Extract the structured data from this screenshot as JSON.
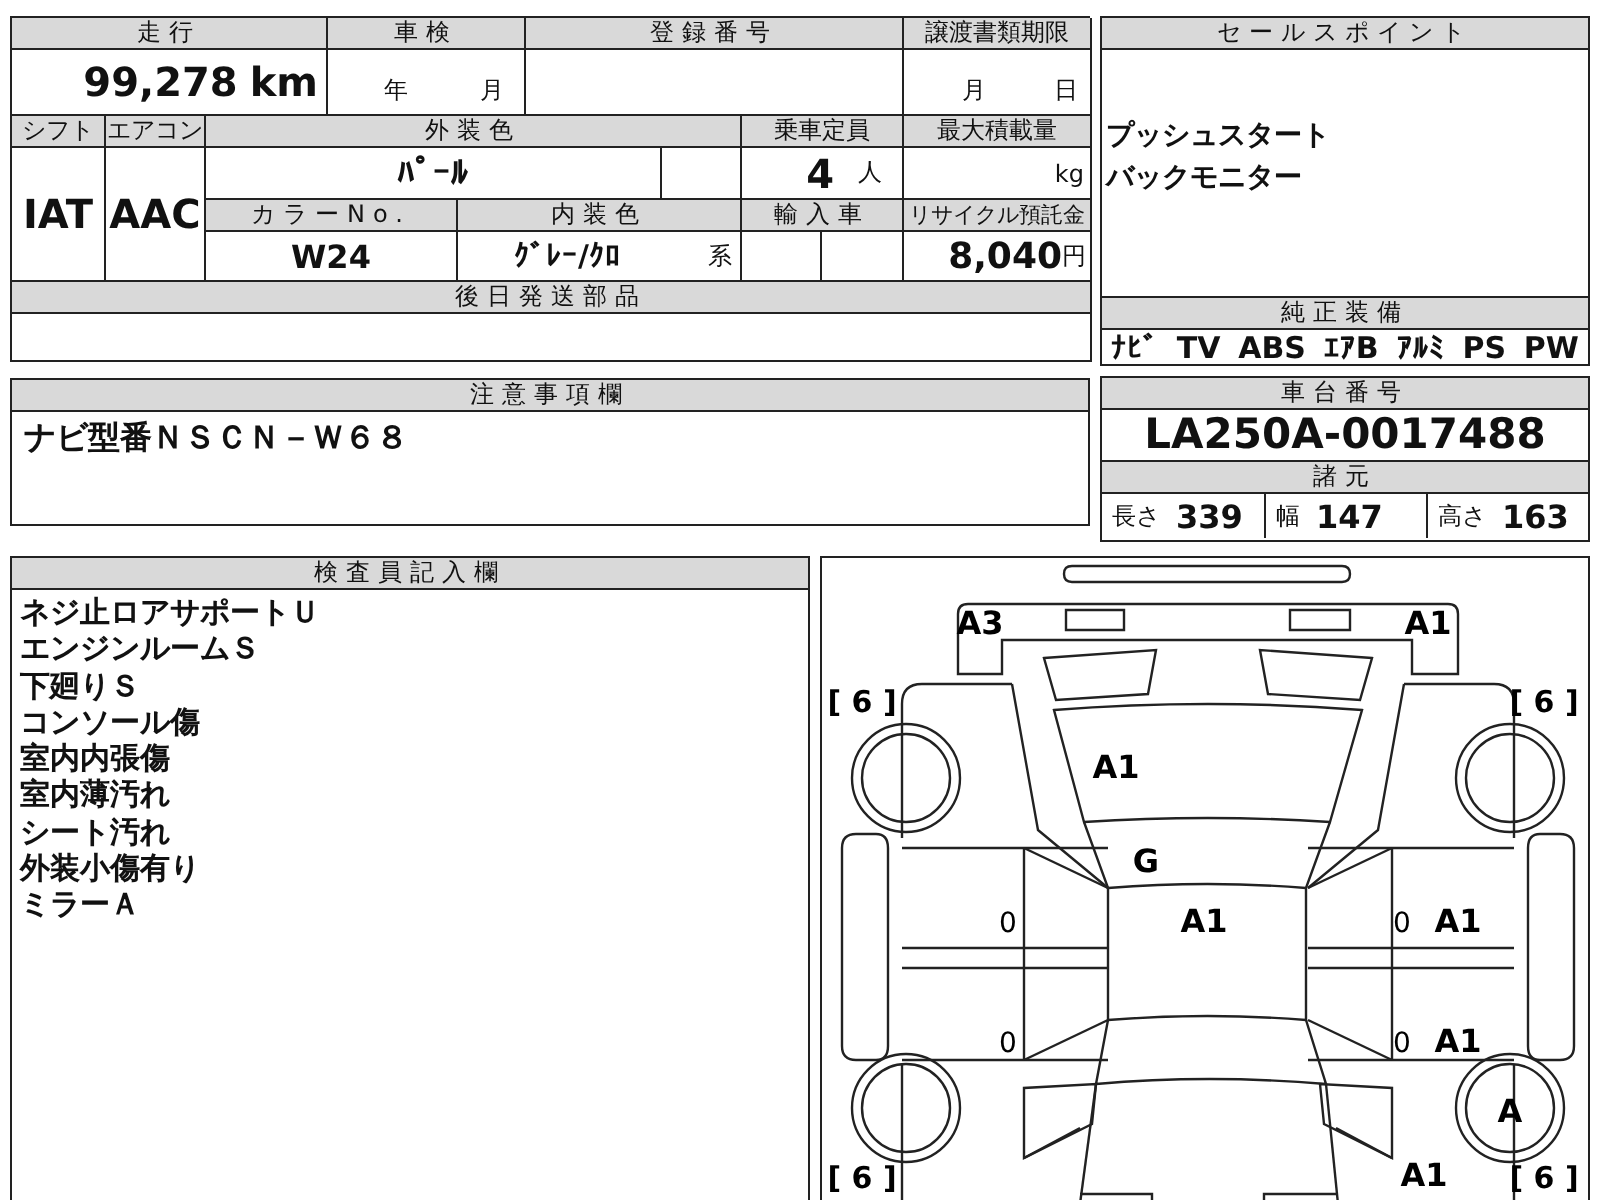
{
  "summary": {
    "mileage_label": "走行",
    "mileage": "99,278",
    "mileage_unit": "km",
    "inspection_label": "車検",
    "inspection_year_unit": "年",
    "inspection_month_unit": "月",
    "registration_label": "登録番号",
    "transfer_deadline_label": "譲渡書類期限",
    "transfer_month_unit": "月",
    "transfer_day_unit": "日",
    "shift_label": "シフト",
    "shift": "IAT",
    "ac_label": "エアコン",
    "ac": "AAC",
    "exterior_color_label": "外装色",
    "exterior_color": "ﾊﾟｰﾙ",
    "capacity_label": "乗車定員",
    "capacity": "4",
    "capacity_unit": "人",
    "max_load_label": "最大積載量",
    "max_load_unit": "kg",
    "color_no_label": "カラーNo.",
    "color_no": "W24",
    "interior_color_label": "内装色",
    "interior_color": "ｸﾞﾚｰ/ｸﾛ",
    "interior_color_suffix": "系",
    "import_label": "輸入車",
    "recycle_label": "リサイクル預託金",
    "recycle_fee": "8,040",
    "recycle_unit": "円",
    "later_parts_label": "後日発送部品"
  },
  "notes": {
    "label": "注意事項欄",
    "text": "ナビ型番ＮＳＣＮ－Ｗ６８"
  },
  "inspector": {
    "label": "検査員記入欄",
    "lines": [
      "ネジ止ロアサポートＵ",
      "エンジンルームＳ",
      "下廻りＳ",
      "コンソール傷",
      "室内内張傷",
      "室内薄汚れ",
      "シート汚れ",
      "外装小傷有り",
      "ミラーＡ"
    ]
  },
  "sales_points": {
    "label": "セールスポイント",
    "lines": [
      "プッシュスタート",
      "バックモニター"
    ]
  },
  "equipment": {
    "label": "純正装備",
    "items": [
      "ﾅﾋﾞ",
      "TV",
      "ABS",
      "ｴｱB",
      "ｱﾙﾐ",
      "PS",
      "PW"
    ]
  },
  "chassis": {
    "label": "車台番号",
    "number": "LA250A-0017488",
    "specs_label": "諸元",
    "specs": [
      {
        "label": "長さ",
        "value": "339"
      },
      {
        "label": "幅",
        "value": "147"
      },
      {
        "label": "高さ",
        "value": "163"
      }
    ]
  },
  "diagram": {
    "front_bumper_left": [
      "A3"
    ],
    "front_bumper_right": [
      "A1"
    ],
    "tire_front_left": "[ 6 ]",
    "tire_front_right": "[ 6 ]",
    "hood": [
      "A1"
    ],
    "windshield": [
      "G"
    ],
    "left_front_door": [
      "0"
    ],
    "roof": [
      "A1"
    ],
    "right_front_door": [
      "0",
      "A1"
    ],
    "left_rear_door": [
      "0"
    ],
    "right_rear_door": [
      "0",
      "A1"
    ],
    "rear_right_wheel": [
      "A"
    ],
    "tire_rear_left": "[ 6 ]",
    "rear_right_quarter": [
      "A1"
    ],
    "tire_rear_right": "[ 6 ]"
  }
}
